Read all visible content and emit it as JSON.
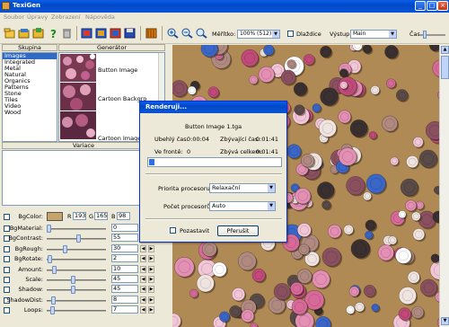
{
  "app": {
    "title": "TexiGen"
  },
  "menu": [
    "Soubor",
    "Úpravy",
    "Zobrazení",
    "Nápověda"
  ],
  "toolbar": {
    "scale_label": "Měřítko:",
    "scale_value": "100% (512)",
    "tiles_label": "Dlaždice",
    "output_label": "Výstup:",
    "output_value": "Main",
    "time_label": "Čas"
  },
  "panels": {
    "group_header": "Skupina",
    "generator_header": "Generátor",
    "variations_header": "Variace"
  },
  "groups": [
    "Images",
    "Integrated",
    "Metal",
    "Natural",
    "Organics",
    "Patterns",
    "Stone",
    "Tiles",
    "Video",
    "Wood"
  ],
  "selected_group": "Images",
  "generators": [
    "Button Image",
    "Cartoon Backgro",
    "Cartoon Image"
  ],
  "params": {
    "bgcolor_label": "BgColor:",
    "bgcolor_swatch": "#c9a46a",
    "r_label": "R",
    "r_value": "193",
    "g_label": "G",
    "g_value": "165",
    "b_label": "B",
    "b_value": "98",
    "rows": [
      {
        "label": "BgMaterial:",
        "value": "0",
        "level": 0.0
      },
      {
        "label": "BgContrast:",
        "value": "55",
        "level": 0.55
      },
      {
        "label": "BgRough:",
        "value": "30",
        "level": 0.3
      },
      {
        "label": "BgRotate:",
        "value": "2",
        "level": 0.02
      },
      {
        "label": "Amount:",
        "value": "10",
        "level": 0.1
      },
      {
        "label": "Scale:",
        "value": "45",
        "level": 0.45
      },
      {
        "label": "Shadow:",
        "value": "45",
        "level": 0.45
      },
      {
        "label": "ShadowDist:",
        "value": "8",
        "level": 0.08
      },
      {
        "label": "Loops:",
        "value": "7",
        "level": 0.07
      }
    ]
  },
  "dialog": {
    "title": "Renderuji...",
    "item": "Button Image 1.tga",
    "elapsed_label": "Ubehlý čas:",
    "elapsed_value": "0:00:04",
    "remaining_label": "Zbývající čas:",
    "remaining_value": "0:01:41",
    "queue_label": "Ve frontě:",
    "queue_value": "0",
    "total_label": "Zbývá celkem:",
    "total_value": "0:01:41",
    "progress": 0.04,
    "priority_label": "Priorita procesoru:",
    "priority_value": "Relaxační",
    "cpu_label": "Počet procesorů:",
    "cpu_value": "Auto",
    "pause_label": "Pozastavit",
    "abort_label": "Přerušit"
  },
  "icons": [
    "new-file-icon",
    "open-folder-icon",
    "save-icon",
    "help-icon",
    "delete-icon",
    "render-icon",
    "zoom-in-icon",
    "zoom-out-icon",
    "zoom-reset-icon"
  ]
}
